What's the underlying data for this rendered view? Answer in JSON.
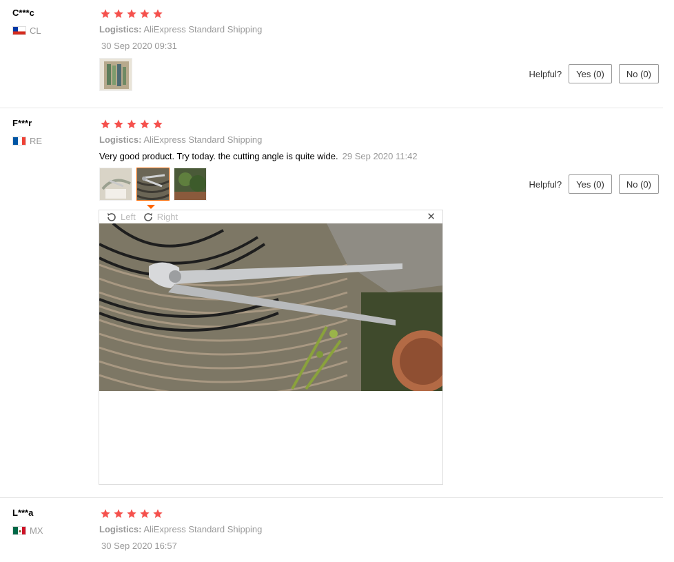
{
  "reviews": [
    {
      "user": "C***c",
      "country": "CL",
      "rating": 5,
      "logistics_label": "Logistics:",
      "logistics_value": "AliExpress Standard Shipping",
      "datetime": "30 Sep 2020 09:31",
      "helpful_label": "Helpful?",
      "yes_label": "Yes (0)",
      "no_label": "No (0)"
    },
    {
      "user": "F***r",
      "country": "RE",
      "rating": 5,
      "logistics_label": "Logistics:",
      "logistics_value": "AliExpress Standard Shipping",
      "text": "Very good product. Try today. the cutting angle is quite wide.",
      "datetime": "29 Sep 2020 11:42",
      "helpful_label": "Helpful?",
      "yes_label": "Yes (0)",
      "no_label": "No (0)"
    },
    {
      "user": "L***a",
      "country": "MX",
      "rating": 5,
      "logistics_label": "Logistics:",
      "logistics_value": "AliExpress Standard Shipping",
      "datetime": "30 Sep 2020 16:57"
    }
  ],
  "viewer": {
    "rotate_left": "Left",
    "rotate_right": "Right",
    "close": "✕"
  },
  "colors": {
    "star": "#f5514d",
    "active_thumb": "#ff6600"
  }
}
